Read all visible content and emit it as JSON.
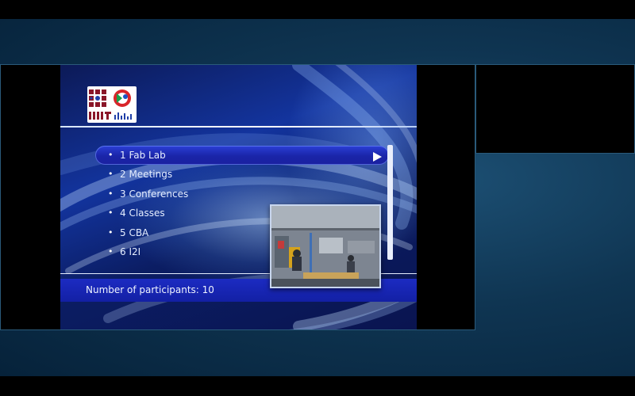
{
  "menu": {
    "items": [
      {
        "label": "1 Fab Lab",
        "selected": true
      },
      {
        "label": "2 Meetings",
        "selected": false
      },
      {
        "label": "3 Conferences",
        "selected": false
      },
      {
        "label": "4 Classes",
        "selected": false
      },
      {
        "label": "5 CBA",
        "selected": false
      },
      {
        "label": "6 I2I",
        "selected": false
      }
    ],
    "bullet": "•"
  },
  "status": {
    "participants_text": "Number of participants: 10"
  },
  "logo": {
    "text": "MIT"
  },
  "colors": {
    "stage_blue": "#13349e",
    "selection": "#2b3fd6",
    "status_bar": "#1c2bc2"
  },
  "icons": {
    "selection_arrow": "triangle-right",
    "logo": "mit-cba-logo"
  }
}
